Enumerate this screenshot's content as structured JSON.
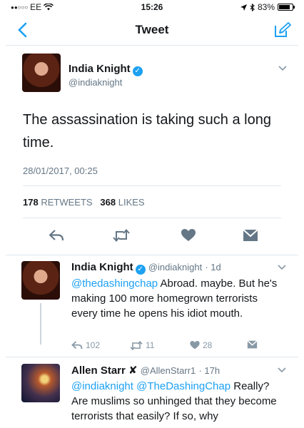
{
  "status_bar": {
    "carrier": "EE",
    "time": "15:26",
    "battery": "83%",
    "battery_level": 0.83
  },
  "nav": {
    "title": "Tweet"
  },
  "main_tweet": {
    "name": "India Knight",
    "handle": "@indiaknight",
    "text": "The assassination is taking such a long time.",
    "timestamp": "28/01/2017, 00:25",
    "retweets_count": "178",
    "retweets_label": "RETWEETS",
    "likes_count": "368",
    "likes_label": "LIKES"
  },
  "replies": [
    {
      "name": "India Knight",
      "handle": "@indiaknight",
      "age": "· 1d",
      "mention": "@thedashingchap",
      "text": " Abroad. maybe. But he's making 100 more homegrown terrorists every time he opens his idiot mouth.",
      "replies_count": "102",
      "retweets_count": "11",
      "likes_count": "28"
    },
    {
      "name": "Allen Starr",
      "name_suffix": "✘",
      "handle": "@AllenStarr1",
      "age": "· 17h",
      "mention": "@indiaknight @TheDashingChap",
      "text": " Really? Are muslims so unhinged that they become terrorists that easily? If so, why"
    }
  ],
  "colors": {
    "accent": "#1da1f2",
    "secondary": "#657786",
    "divider": "#e1e8ed"
  }
}
